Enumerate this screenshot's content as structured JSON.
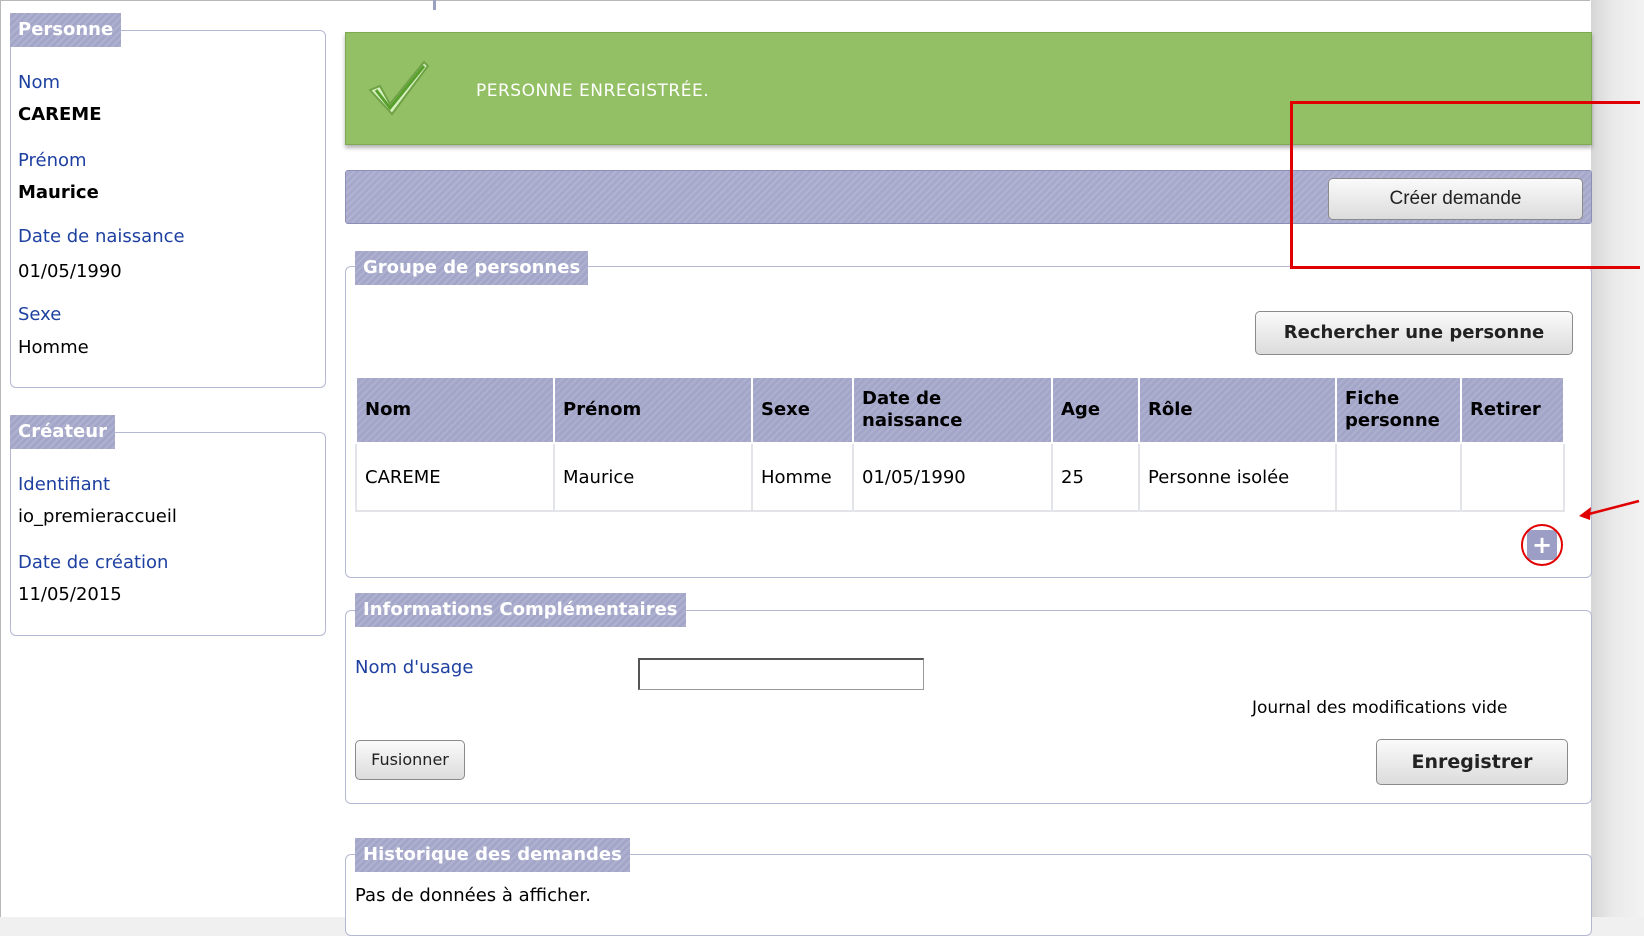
{
  "personne": {
    "legend": "Personne",
    "nom_label": "Nom",
    "nom": "CAREME",
    "prenom_label": "Prénom",
    "prenom": "Maurice",
    "naissance_label": "Date de naissance",
    "naissance": "01/05/1990",
    "sexe_label": "Sexe",
    "sexe": "Homme"
  },
  "createur": {
    "legend": "Créateur",
    "identifiant_label": "Identifiant",
    "identifiant": "io_premieraccueil",
    "creation_label": "Date de création",
    "creation": "11/05/2015"
  },
  "success": {
    "message": "PERSONNE ENREGISTRÉE."
  },
  "toolbar": {
    "create_label": "Créer demande"
  },
  "groupe": {
    "legend": "Groupe de personnes",
    "search_label": "Rechercher une personne",
    "headers": [
      "Nom",
      "Prénom",
      "Sexe",
      "Date de naissance",
      "Age",
      "Rôle",
      "Fiche personne",
      "Retirer"
    ],
    "rows": [
      [
        "CAREME",
        "Maurice",
        "Homme",
        "01/05/1990",
        "25",
        "Personne isolée",
        "",
        ""
      ]
    ],
    "add_label": "+"
  },
  "infos": {
    "legend": "Informations Complémentaires",
    "nom_usage_label": "Nom d'usage",
    "nom_usage_value": "",
    "journal": "Journal des modifications vide",
    "fusionner_label": "Fusionner",
    "enregistrer_label": "Enregistrer"
  },
  "historique": {
    "legend": "Historique des demandes",
    "empty": "Pas de données à afficher."
  },
  "colors": {
    "success_green": "#93c064",
    "legend_purple": "#a4a6c9",
    "label_blue": "#1e40a0",
    "annotation_red": "#e00000"
  }
}
